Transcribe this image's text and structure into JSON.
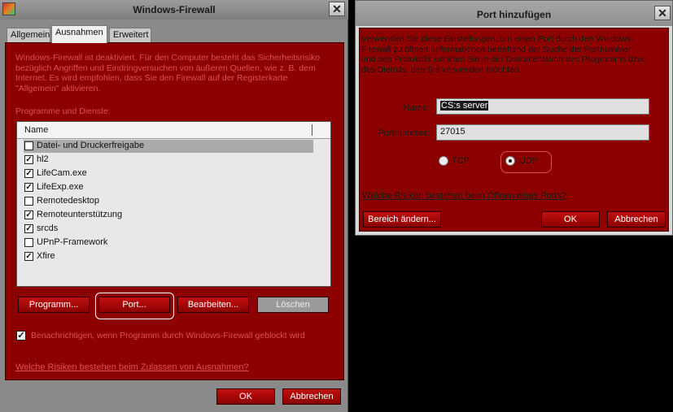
{
  "firewall": {
    "title": "Windows-Firewall",
    "tabs": [
      "Allgemein",
      "Ausnahmen",
      "Erweitert"
    ],
    "description": "Windows-Firewall ist deaktiviert. Für den Computer besteht das Sicherheitsrisiko bezüglich Angriffen und Eindringversuchen von äußeren Quellen, wie z. B. dem Internet. Es wird empfohlen, dass Sie den Firewall auf der Registerkarte \"Allgemein\" aktivieren.",
    "programs_label": "Programme und Dienste:",
    "column_header": "Name",
    "items": [
      {
        "label": "Datei- und Druckerfreigabe",
        "checked": false
      },
      {
        "label": "hl2",
        "checked": true
      },
      {
        "label": "LifeCam.exe",
        "checked": true
      },
      {
        "label": "LifeExp.exe",
        "checked": true
      },
      {
        "label": "Remotedesktop",
        "checked": false
      },
      {
        "label": "Remoteunterstützung",
        "checked": true
      },
      {
        "label": "srcds",
        "checked": true
      },
      {
        "label": "UPnP-Framework",
        "checked": false
      },
      {
        "label": "Xfire",
        "checked": true
      }
    ],
    "buttons": {
      "program": "Programm...",
      "port": "Port...",
      "edit": "Bearbeiten...",
      "delete": "Löschen",
      "ok": "OK",
      "cancel": "Abbrechen"
    },
    "notify_text": "Benachrichtigen, wenn Programm durch Windows-Firewall geblockt wird",
    "risk_link": "Welche Risiken bestehen beim Zulassen von Ausnahmen?"
  },
  "port_dialog": {
    "title": "Port hinzufügen",
    "description": "Verwenden Sie diese Einstellungen, um einen Port durch den Windows-Firewall zu öffnen. Informationen betreffend der Suche der Portnummer und des Protokolls erhalten Sie in der Dokumentation des Programms bzw. des Diensts, den Sie verwenden möchten.",
    "name_label": "Name:",
    "name_value": "CS:s server",
    "port_label": "Portnummer:",
    "port_value": "27015",
    "tcp_label": "TCP",
    "udp_label": "UDP",
    "protocol_selected": "UDP",
    "risk_link": "Welche Risiken bestehen beim Öffnen eines Ports?",
    "buttons": {
      "scope": "Bereich ändern...",
      "ok": "OK",
      "cancel": "Abbrechen"
    }
  },
  "colors": {
    "panel_red": "#8d0000",
    "button_red": "#c21010",
    "highlight_text": "#e05050"
  },
  "icons": {
    "close": "close-icon",
    "app": "firewall-app-icon",
    "checkmark": "checkmark-icon"
  }
}
